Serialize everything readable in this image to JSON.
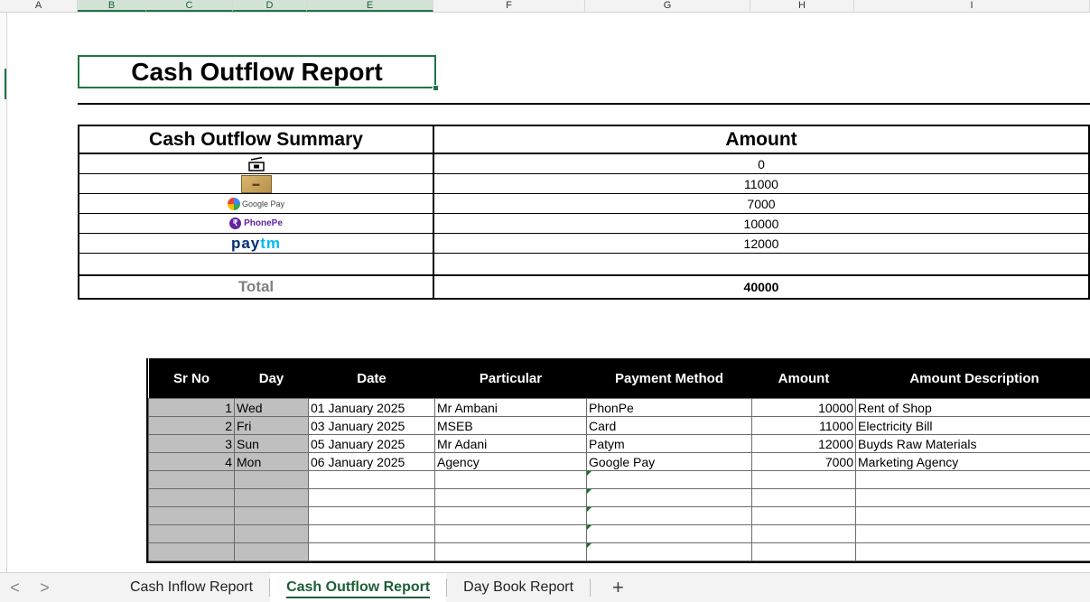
{
  "columns": [
    "A",
    "B",
    "C",
    "D",
    "E",
    "F",
    "G",
    "H",
    "I"
  ],
  "title": "Cash Outflow Report",
  "summary": {
    "header_left": "Cash Outflow Summary",
    "header_right": "Amount",
    "rows": [
      {
        "method": "cash-icon",
        "amount": "0"
      },
      {
        "method": "card-icon",
        "amount": "11000"
      },
      {
        "method": "google-pay-logo",
        "amount": "7000"
      },
      {
        "method": "phonepe-logo",
        "amount": "10000"
      },
      {
        "method": "paytm-logo",
        "amount": "12000"
      }
    ],
    "logo_text": {
      "gpay": "Google Pay",
      "phonepe": "PhonePe",
      "paytm_a": "pay",
      "paytm_b": "tm"
    },
    "total_label": "Total",
    "total_value": "40000"
  },
  "transactions": {
    "headers": [
      "Sr No",
      "Day",
      "Date",
      "Particular",
      "Payment Method",
      "Amount",
      "Amount Description"
    ],
    "rows": [
      [
        "1",
        "Wed",
        "01 January 2025",
        "Mr Ambani",
        "PhonPe",
        "10000",
        "Rent of Shop"
      ],
      [
        "2",
        "Fri",
        "03 January 2025",
        "MSEB",
        "Card",
        "11000",
        "Electricity Bill"
      ],
      [
        "3",
        "Sun",
        "05 January 2025",
        "Mr Adani",
        "Patym",
        "12000",
        "Buyds Raw Materials"
      ],
      [
        "4",
        "Mon",
        "06 January 2025",
        "Agency",
        "Google Pay",
        "7000",
        "Marketing Agency"
      ]
    ]
  },
  "sheet_tabs": [
    "Cash Inflow Report",
    "Cash Outflow Report",
    "Day Book Report"
  ],
  "active_tab": "Cash Outflow Report",
  "nav": {
    "prev": "<",
    "next": ">",
    "add": "+"
  },
  "colors": {
    "accent": "#217346",
    "header_bg": "#000000",
    "grey_cell": "#bfbfbf"
  }
}
